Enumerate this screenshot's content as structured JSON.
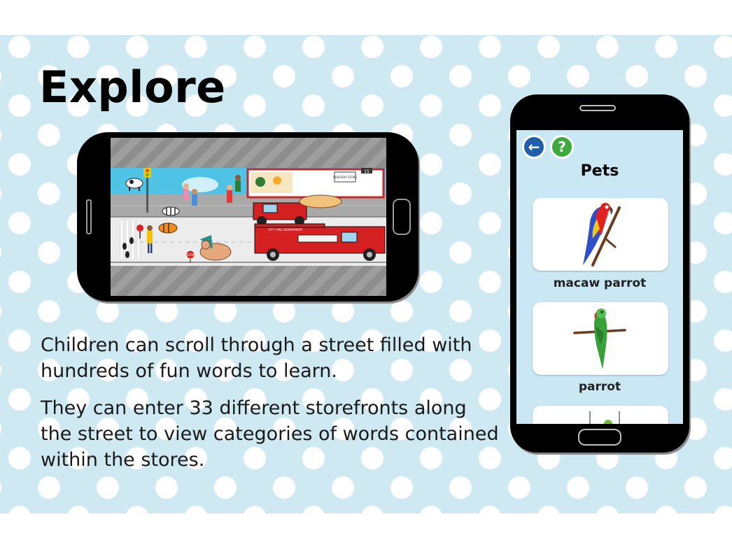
{
  "slide": {
    "title": "Explore",
    "paragraphs": [
      "Children can scroll through a street filled with hundreds of fun words to learn.",
      "They can enter 33 different storefronts along the street to view categories of words contained within the stores."
    ]
  },
  "street_scene": {
    "store_sign": "GROCERY STORE",
    "address_number": "15",
    "fire_truck_text": "CITY FIRE DEPARTMENT",
    "stop_sign": "STOP"
  },
  "app": {
    "category_title": "Pets",
    "back_icon": "arrow-left-icon",
    "help_icon": "question-mark-icon",
    "words": [
      {
        "label": "macaw parrot",
        "icon": "macaw-parrot-icon"
      },
      {
        "label": "parrot",
        "icon": "parrot-icon"
      }
    ]
  },
  "colors": {
    "background": "#cfe9f3",
    "dots": "#ffffff",
    "back_button": "#1f5fa8",
    "help_button": "#3caa3c",
    "fire_truck": "#d42020"
  }
}
